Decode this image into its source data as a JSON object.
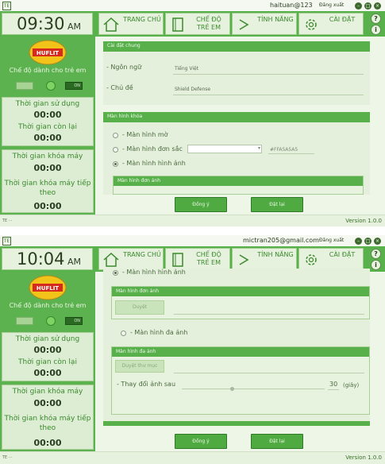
{
  "nav": [
    {
      "label": "TRANG CHỦ",
      "icon": "home-icon"
    },
    {
      "label": "CHẾ ĐỘ TRẺ EM",
      "icon": "book-icon"
    },
    {
      "label": "TÍNH NĂNG",
      "icon": "chevron-icon"
    },
    {
      "label": "CÀI ĐẶT",
      "icon": "gear-icon"
    }
  ],
  "titlebar": {
    "logout": "Đăng xuất",
    "minimize": "–",
    "maximize": "□",
    "close": "×"
  },
  "header_buttons": {
    "help": "?",
    "info": "i"
  },
  "sidebar": {
    "logo_text": "HUFLIT",
    "mode_label": "Chế độ dành cho trẻ em",
    "toggle_on": "ON",
    "used_label": "Thời gian sử dụng",
    "remaining_label": "Thời gian còn lại",
    "lock_label": "Thời gian khóa máy",
    "next_lock_label": "Thời gian khóa máy tiếp theo"
  },
  "footer": {
    "version": "Version 1.0.0"
  },
  "actions": {
    "ok": "Đồng ý",
    "reset": "Đặt lại"
  },
  "screen1": {
    "user": "haituan@123",
    "time": "09:30",
    "ampm": "AM",
    "used_value": "00:00",
    "remaining_value": "00:00",
    "lock_value": "00:00",
    "next_value": "00:00",
    "general_header": "Cài đặt chung",
    "language_label": "- Ngôn ngữ",
    "language_value": "Tiếng Việt",
    "theme_label": "- Chủ đề",
    "theme_value": "Shield Defense",
    "lock_header": "Màn hình khóa",
    "opt_blur": "- Màn hình mờ",
    "opt_solid": "- Màn hình đơn sắc",
    "color_hex": "#FFA5A5A5",
    "opt_image": "- Màn hình hình ảnh",
    "single_image_header": "Màn hình đơn ảnh"
  },
  "screen2": {
    "user": "mictran205@gmail.com",
    "time": "10:04",
    "ampm": "AM",
    "used_value": "00:00",
    "remaining_value": "00:00",
    "lock_value": "00:00",
    "next_value": "00:00",
    "opt_image": "- Màn hình hình ảnh",
    "single_image_header": "Màn hình đơn ảnh",
    "browse_button": "Duyệt",
    "multi_image_option": "- Màn hình đa ảnh",
    "multi_image_header": "Màn hình đa ảnh",
    "browse_folder_button": "Duyệt thư mục",
    "change_interval_label": "- Thay đổi ảnh sau",
    "interval_value": "30",
    "interval_unit": "(giây)",
    "interval_fraction": 0.35
  }
}
